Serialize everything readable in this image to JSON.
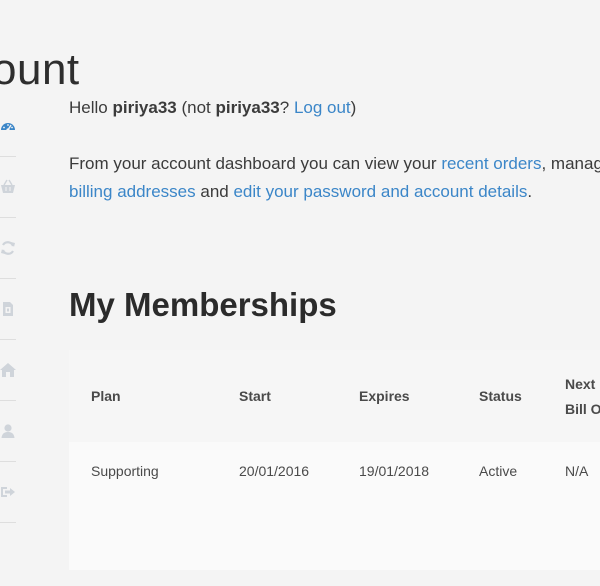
{
  "page": {
    "title": "ount"
  },
  "sidebar": {
    "items": [
      {
        "icon": "dashboard-icon"
      },
      {
        "icon": "basket-icon"
      },
      {
        "icon": "refresh-icon"
      },
      {
        "icon": "document-icon"
      },
      {
        "icon": "home-icon"
      },
      {
        "icon": "user-icon"
      },
      {
        "icon": "logout-icon"
      }
    ]
  },
  "greeting": {
    "hello": "Hello ",
    "username": "piriya33",
    "not_prefix": " (not ",
    "username2": "piriya33",
    "question": "? ",
    "logout_link": "Log out",
    "close_paren": ")"
  },
  "dashboard": {
    "intro": "From your account dashboard you can view your ",
    "recent_orders_link": "recent orders",
    "manage_text": ", manage y",
    "billing_link": "billing addresses",
    "and_text": " and ",
    "edit_link": "edit your password and account details",
    "period": "."
  },
  "memberships": {
    "title": "My Memberships",
    "headers": {
      "plan": "Plan",
      "start": "Start",
      "expires": "Expires",
      "status": "Status",
      "next_line1": "Next",
      "next_line2": "Bill O"
    },
    "rows": [
      {
        "plan": "Supporting",
        "start": "20/01/2016",
        "expires": "19/01/2018",
        "status": "Active",
        "next_bill": "N/A"
      }
    ]
  },
  "colors": {
    "link": "#3b86c8",
    "icon_active": "#3b86c8",
    "icon_inactive": "#cfd4da"
  }
}
